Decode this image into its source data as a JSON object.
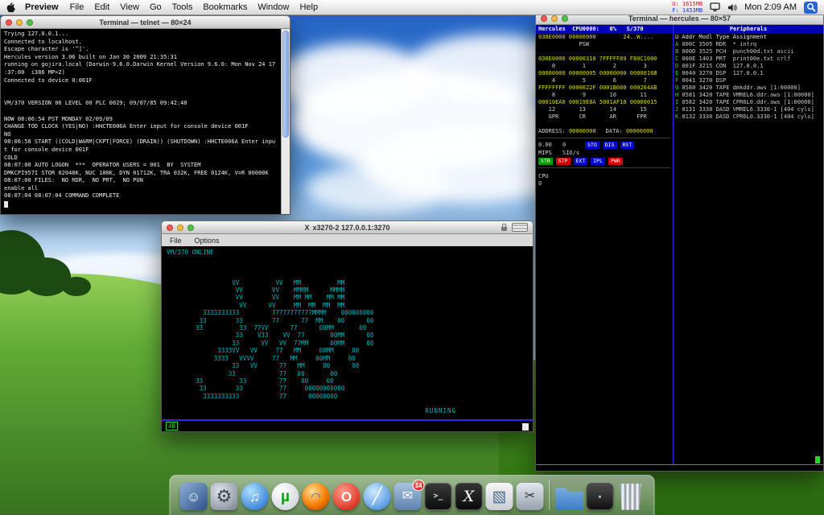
{
  "menu_bar": {
    "app_name": "Preview",
    "menus": [
      "File",
      "Edit",
      "View",
      "Go",
      "Tools",
      "Bookmarks",
      "Window",
      "Help"
    ],
    "memory_used": "U: 1615MB",
    "memory_free": "F: 1453MB",
    "clock": "Mon 2:09 AM"
  },
  "telnet": {
    "title": "Terminal — telnet — 80×24",
    "lines": [
      "Trying 127.0.0.1...",
      "Connected to localhost.",
      "Escape character is '^]'.",
      "Hercules version 3.06 built on Jan 30 2009 21:35:31",
      "running on gojira.local (Darwin-9.6.0.Darwin Kernel Version 9.6.0: Mon Nov 24 17",
      ":37:00  i386 MP=2)",
      "Connected to device 0:001F",
      "",
      "",
      "VM/370 VERSION 06 LEVEL 00 PLC 0029; 09/07/85 09:42:40",
      "",
      "NOW 08:06:54 PST MONDAY 02/09/09",
      "CHANGE TOD CLOCK (YES|NO) :HHCTE006A Enter input for console device 001F",
      "NO",
      "08:06:58 START ((COLD|WARM|CKPT|FORCE) (DRAIN)) (SHUTDOWN) :HHCTE006A Enter inpu",
      "t for console device 001F",
      "COLD",
      "08:07:00 AUTO LOGON  ***  OPERATOR USERS = 001  BY  SYSTEM",
      "DMKCPI957I STOR 02048K, NUC 180K, DYN 01712K, TRA 032K, FREE 0124K, V=R 00000K",
      "08:07:00 FILES:  NO RDR,  NO PRT,  NO PUN",
      "enable all",
      "08:07:04 08:07:04 COMMAND COMPLETE"
    ]
  },
  "x3270": {
    "app_glyph": "X",
    "title": "x3270-2 127.0.0.1:3270",
    "menus": [
      "File",
      "Options"
    ],
    "screen_lines": [
      "VM/370 ONLINE",
      "",
      "",
      "",
      "                  VV          VV   MM          MM",
      "                   VV        VV    MMMM      MMMM",
      "                   VV        VV    MM MM    MM MM",
      "                    VV      VV     MM  MM  MM  MM",
      "          3333333333         77777777777MMMM    000000000",
      "         33        33        77      77  MM    00      00",
      "        33          33  77VV      77      00MM       00",
      "                   33    V33    VV  77       00MM      00",
      "                  33      VV   VV  77MM      00MM      00",
      "              3333VV   VV     77   MM     00MM     00",
      "             3333   VVVV     77   MM     00MM     00",
      "                  33   VV      77   MM     00      00",
      "                 33            77   00       00",
      "        33          33         77    00     00",
      "         33        33          77     00000000000",
      "          3333333333           77      00000000"
    ],
    "status_running": "RUNNING",
    "oia_indicator": "4B"
  },
  "hercules": {
    "title": "Terminal — hercules — 80×57",
    "panel_header": "Hercules  CPU0000:   0%   S/370",
    "peripherals_header": "Peripherals",
    "panel_lines": [
      {
        "t": "030E0000 00000000        24..W....",
        "c": "y"
      },
      {
        "t": "            PSW",
        "c": "w"
      },
      {
        "t": "",
        "c": "w"
      },
      {
        "t": "030E0000 00000310 7FFFFF89 F80C1000",
        "c": "y"
      },
      {
        "t": "    0        1        2        3",
        "c": "w"
      },
      {
        "t": "00000000 00000005 00000000 0000016B",
        "c": "y"
      },
      {
        "t": "    4        5        6        7",
        "c": "w"
      },
      {
        "t": "FFFFFFFF 0000022F 0001B000 000264AB",
        "c": "y"
      },
      {
        "t": "    8        9       10       11",
        "c": "w"
      },
      {
        "t": "00010EA0 00019E8A 5001AF18 00000015",
        "c": "y"
      },
      {
        "t": "   12       13       14       15",
        "c": "w"
      },
      {
        "t": "   GPR      CR       AR      FPR",
        "c": "w"
      },
      {
        "t": "",
        "c": "w"
      }
    ],
    "address_label": "ADDRESS:",
    "address_value": "00000000",
    "data_label": "DATA:",
    "data_value": "00000000",
    "mips_value": "0.00",
    "sio_value": "0",
    "mips_label": "MIPS",
    "sio_label": "SIO/s",
    "buttons_top": [
      {
        "label": "STO",
        "color": "blue"
      },
      {
        "label": "DIS",
        "color": "blue"
      },
      {
        "label": "RST",
        "color": "blue"
      }
    ],
    "buttons_bottom": [
      {
        "label": "STR",
        "color": "green"
      },
      {
        "label": "STP",
        "color": "red"
      },
      {
        "label": "EXT",
        "color": "blue"
      },
      {
        "label": "IPL",
        "color": "blue"
      },
      {
        "label": "PWR",
        "color": "red"
      }
    ],
    "cpu_label": "CPU",
    "cpu_value": "0",
    "peripherals_columns": "U Addr Modl Type Assignment",
    "peripherals": [
      "A 000C 3505 RDR  * intrq",
      "B 000D 3525 PCH  punch00d.txt ascii",
      "C 000E 1403 PRT  print00e.txt crlf",
      "D 001F 3215 CON  127.0.0.1",
      "E 0040 3270 DSP  127.0.0.1",
      "F 0041 3270 DSP",
      "G 0580 3420 TAPE dmkddr.aws [1:00000]",
      "H 0581 3420 TAPE VMREL6.ddr.aws [1:00000]",
      "I 0582 3420 TAPE CPR6L0.ddr.aws [1:00000]",
      "J 0131 3330 DASD VMREL6.3330-1 [404 cyls]",
      "K 0132 3330 DASD CPR6L0.3330-1 [404 cyls]"
    ]
  },
  "dock": {
    "items": [
      {
        "name": "classic-app-icon",
        "style": "classic",
        "glyph": "☺"
      },
      {
        "name": "system-preferences-icon",
        "style": "sysprefs",
        "glyph": "⚙"
      },
      {
        "name": "itunes-icon",
        "style": "itunes",
        "glyph": "♫"
      },
      {
        "name": "utorrent-icon",
        "style": "utorrent",
        "glyph": "µ"
      },
      {
        "name": "firefox-icon",
        "style": "firefox",
        "glyph": "◠"
      },
      {
        "name": "opera-icon",
        "style": "opera",
        "glyph": "O"
      },
      {
        "name": "safari-icon",
        "style": "safari",
        "glyph": "╱"
      },
      {
        "name": "mail-icon",
        "style": "mail",
        "glyph": "✉",
        "badge": "14"
      },
      {
        "name": "terminal-icon",
        "style": "terminal",
        "glyph": ">_"
      },
      {
        "name": "x11-icon",
        "style": "x11",
        "glyph": "X"
      },
      {
        "name": "preview-icon",
        "style": "preview",
        "glyph": "▧"
      },
      {
        "name": "grab-icon",
        "style": "grab",
        "glyph": "✂"
      },
      {
        "name": "applications-folder-icon",
        "style": "folder",
        "glyph": ""
      },
      {
        "name": "utilities-app-icon",
        "style": "dark",
        "glyph": "▪"
      },
      {
        "name": "trash-icon",
        "style": "trash",
        "glyph": ""
      }
    ]
  }
}
